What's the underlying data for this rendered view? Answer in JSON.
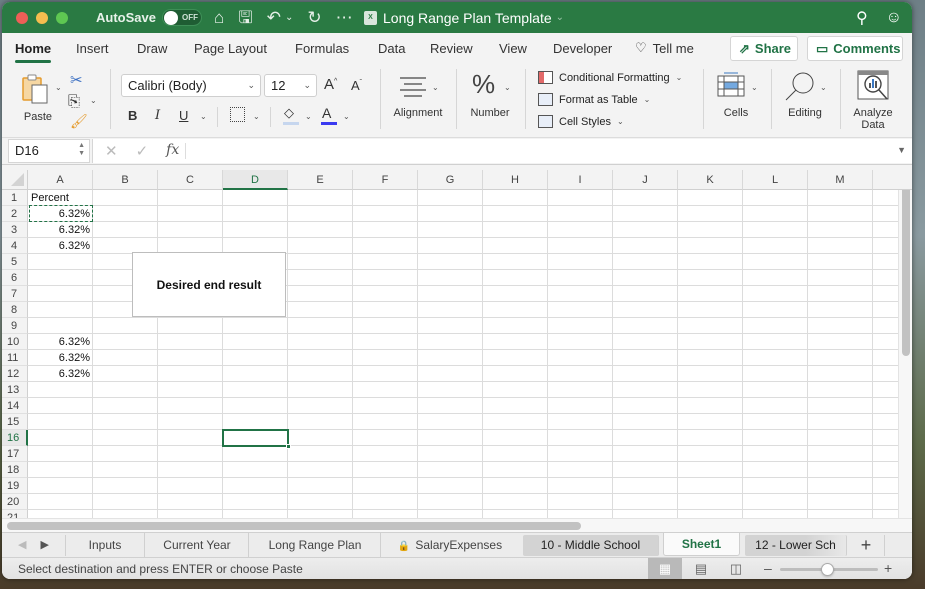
{
  "titlebar": {
    "autosave_label": "AutoSave",
    "autosave_state": "OFF",
    "document_title": "Long Range Plan Template",
    "file_badge": "X"
  },
  "ribbon_tabs": [
    {
      "label": "Home",
      "active": true
    },
    {
      "label": "Insert"
    },
    {
      "label": "Draw"
    },
    {
      "label": "Page Layout"
    },
    {
      "label": "Formulas"
    },
    {
      "label": "Data"
    },
    {
      "label": "Review"
    },
    {
      "label": "View"
    },
    {
      "label": "Developer"
    }
  ],
  "tell_me": "Tell me",
  "share_label": "Share",
  "comments_label": "Comments",
  "ribbon": {
    "paste_label": "Paste",
    "font_name": "Calibri (Body)",
    "font_size": "12",
    "bold": "B",
    "italic": "I",
    "underline": "U",
    "font_color": "#3a3af0",
    "fill_color": "#c6d6ee",
    "alignment_label": "Alignment",
    "number_label": "Number",
    "number_glyph": "%",
    "conditional_formatting": "Conditional Formatting",
    "format_as_table": "Format as Table",
    "cell_styles": "Cell Styles",
    "cells_label": "Cells",
    "editing_label": "Editing",
    "analyze_data_label_1": "Analyze",
    "analyze_data_label_2": "Data"
  },
  "formula_bar": {
    "name_box": "D16",
    "formula": "",
    "fx_label": "fx"
  },
  "grid": {
    "columns": [
      "A",
      "B",
      "C",
      "D",
      "E",
      "F",
      "G",
      "H",
      "I",
      "J",
      "K",
      "L",
      "M"
    ],
    "selected_column": "D",
    "rows": [
      "1",
      "2",
      "3",
      "4",
      "5",
      "6",
      "7",
      "8",
      "9",
      "10",
      "11",
      "12",
      "13",
      "14",
      "15",
      "16",
      "17",
      "18",
      "19",
      "20",
      "21"
    ],
    "selected_row": "16",
    "cells": {
      "A1": "Percent",
      "A2": "6.32%",
      "A3": "6.32%",
      "A4": "6.32%",
      "A10": "6.32%",
      "A11": "6.32%",
      "A12": "6.32%"
    },
    "copy_range": "A2",
    "active_cell": "D16",
    "textbox": "Desired end result"
  },
  "sheet_tabs": [
    {
      "label": "Inputs"
    },
    {
      "label": "Current Year"
    },
    {
      "label": "Long Range Plan"
    },
    {
      "label": "SalaryExpenses",
      "locked": true
    },
    {
      "label": "10 - Middle School",
      "grouped": true
    },
    {
      "label": "Sheet1",
      "active": true
    },
    {
      "label": "12 - Lower Sch",
      "grouped": true
    }
  ],
  "status_bar": {
    "message": "Select destination and press ENTER or choose Paste",
    "zoom_percent": 70
  },
  "colors": {
    "accent": "#217346",
    "titlebar": "#2a7a43"
  }
}
